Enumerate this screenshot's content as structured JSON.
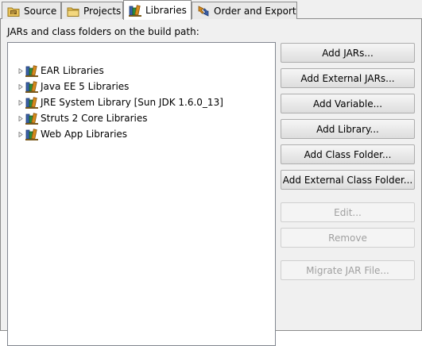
{
  "tabs": [
    {
      "label": "Source",
      "icon": "source-folder-icon"
    },
    {
      "label": "Projects",
      "icon": "project-folder-icon"
    },
    {
      "label": "Libraries",
      "icon": "libraries-icon",
      "active": true
    },
    {
      "label": "Order and Export",
      "icon": "order-export-icon"
    }
  ],
  "build_path_label": "JARs and class folders on the build path:",
  "libraries": [
    {
      "label": "EAR Libraries"
    },
    {
      "label": "Java EE 5 Libraries"
    },
    {
      "label": "JRE System Library [Sun JDK 1.6.0_13]"
    },
    {
      "label": "Struts 2 Core Libraries"
    },
    {
      "label": "Web App Libraries"
    }
  ],
  "buttons": {
    "add_jars": "Add JARs...",
    "add_external_jars": "Add External JARs...",
    "add_variable": "Add Variable...",
    "add_library": "Add Library...",
    "add_class_folder": "Add Class Folder...",
    "add_external_class_folder": "Add External Class Folder...",
    "edit": "Edit...",
    "remove": "Remove",
    "migrate_jar": "Migrate JAR File..."
  },
  "colors": {
    "book_blue": "#3a5fa8",
    "book_green": "#2f8f3a",
    "book_orange": "#d68a1c",
    "folder_yellow": "#e8c25a",
    "disabled_text": "#a0a0a0"
  }
}
